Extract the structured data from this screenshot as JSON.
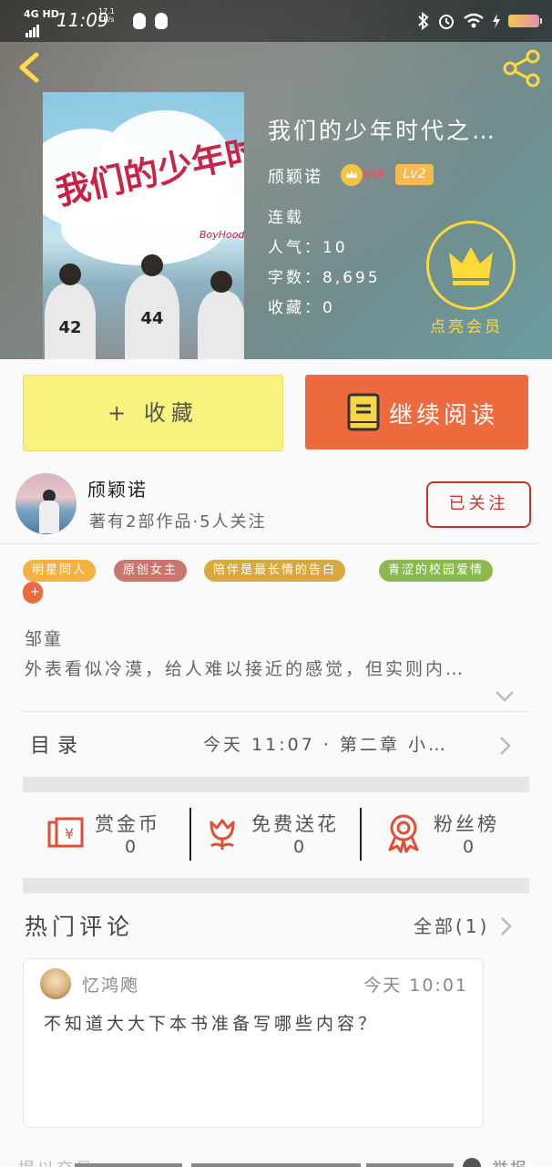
{
  "status_bar": {
    "network": "4G HD",
    "time": "11:09",
    "speed_value": "17.1",
    "speed_unit": "KB/s",
    "battery": "86"
  },
  "book": {
    "title": "我们的少年时代之…",
    "author": "颀颖诺",
    "vip_label": "VIP",
    "level": "Lv2",
    "status": "连载",
    "popularity": "人气：10",
    "word_count": "字数：8,695",
    "favorites": "收藏：0",
    "member_label": "点亮会员",
    "cover": {
      "title_text": "我们的少年时代",
      "english_text": "BoyHood",
      "jersey_numbers": [
        "42",
        "44",
        "",
        ""
      ]
    }
  },
  "actions": {
    "collect_label": "+ 收藏",
    "read_label": "继续阅读"
  },
  "author_block": {
    "name": "颀颖诺",
    "stats": "著有2部作品·5人关注",
    "follow_label": "已关注"
  },
  "tags": [
    {
      "label": "明星同人",
      "color": "#f6b13f"
    },
    {
      "label": "原创女主",
      "color": "#c8776a"
    },
    {
      "label": "陪伴是最长情的告白",
      "color": "#d8a93e"
    },
    {
      "label": "青涩的校园爱情",
      "color": "#8bb84f"
    },
    {
      "label": "+",
      "color": "#ec6a3d"
    }
  ],
  "intro": {
    "name": "邹童",
    "text": "外表看似冷漠，给人难以接近的感觉，但实则内…"
  },
  "toc": {
    "label": "目录",
    "latest": "今天 11:07 · 第二章 小…"
  },
  "stats": [
    {
      "label": "赏金币",
      "value": "0",
      "icon": "red-envelope-icon"
    },
    {
      "label": "免费送花",
      "value": "0",
      "icon": "flower-icon"
    },
    {
      "label": "粉丝榜",
      "value": "0",
      "icon": "medal-icon"
    }
  ],
  "comments": {
    "title": "热门评论",
    "all_label": "全部(1)",
    "items": [
      {
        "user": "忆鸿飑",
        "time": "今天 10:01",
        "text": "不知道大大下本书准备写哪些内容？"
      }
    ]
  },
  "bottom_partial": {
    "left": "提以交易",
    "right": "举报"
  },
  "colors": {
    "accent_orange": "#ec6a3d",
    "collect_yellow": "#f9f37e",
    "member_gold": "#ffd93b",
    "follow_red": "#c8322c"
  }
}
